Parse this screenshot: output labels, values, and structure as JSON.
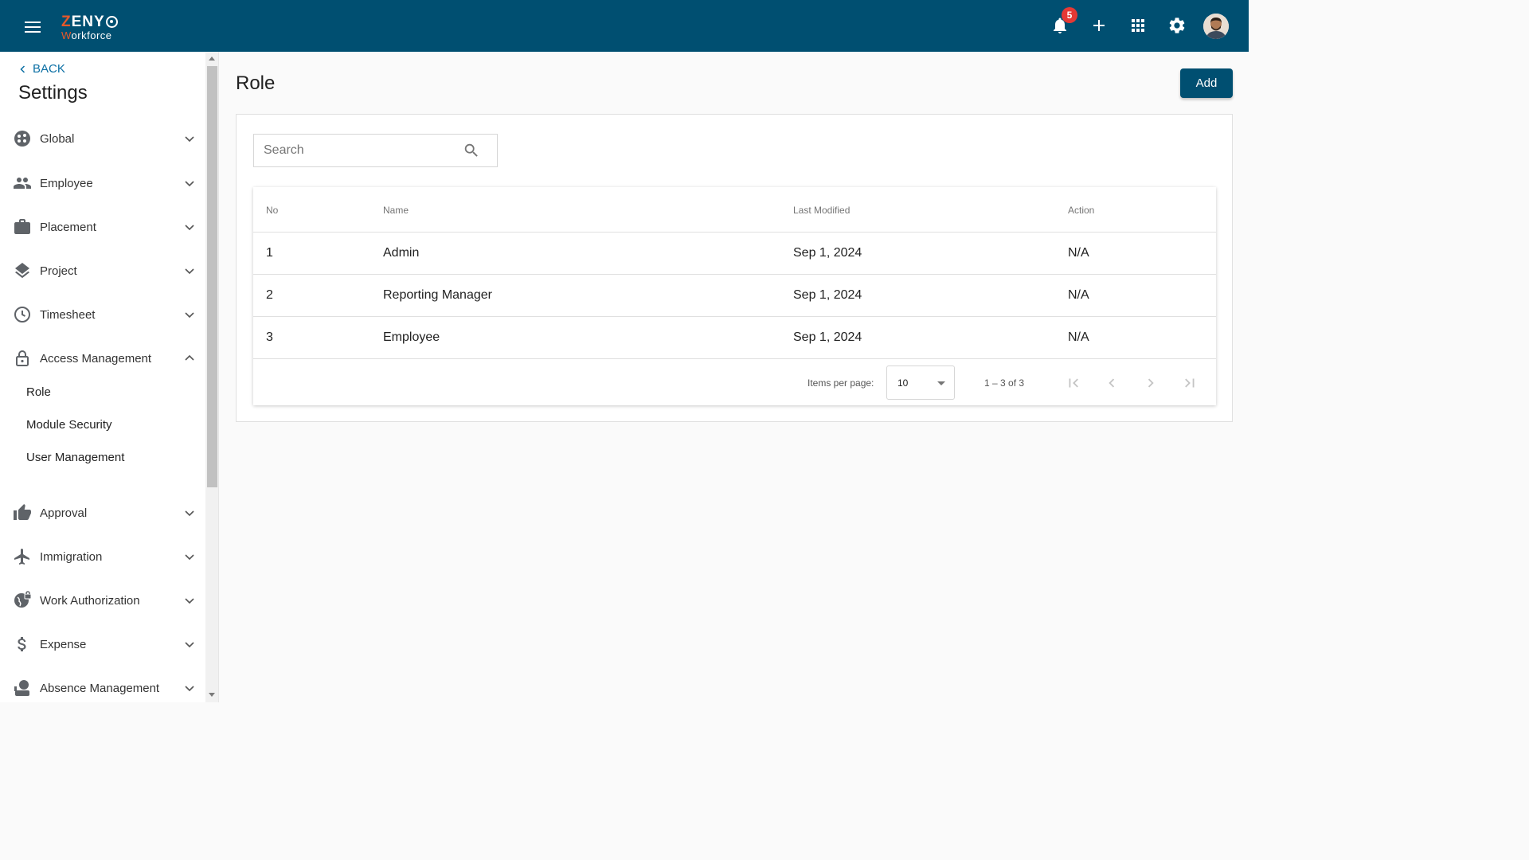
{
  "header": {
    "logo_top": "ZENY",
    "logo_bottom": "Workforce",
    "notification_count": "5",
    "icons": [
      "menu-icon",
      "bell-icon",
      "plus-icon",
      "apps-grid-icon",
      "gear-icon",
      "user-avatar"
    ]
  },
  "sidebar": {
    "back_label": "BACK",
    "title": "Settings",
    "items": [
      {
        "label": "Global",
        "icon": "global-icon",
        "expanded": false
      },
      {
        "label": "Employee",
        "icon": "people-icon",
        "expanded": false
      },
      {
        "label": "Placement",
        "icon": "briefcase-icon",
        "expanded": false
      },
      {
        "label": "Project",
        "icon": "layers-icon",
        "expanded": false
      },
      {
        "label": "Timesheet",
        "icon": "clock-icon",
        "expanded": false
      },
      {
        "label": "Access Management",
        "icon": "lock-icon",
        "expanded": true
      },
      {
        "label": "Approval",
        "icon": "thumbs-up-icon",
        "expanded": false
      },
      {
        "label": "Immigration",
        "icon": "airplane-icon",
        "expanded": false
      },
      {
        "label": "Work Authorization",
        "icon": "globe-lock-icon",
        "expanded": false
      },
      {
        "label": "Expense",
        "icon": "dollar-icon",
        "expanded": false
      },
      {
        "label": "Absence Management",
        "icon": "absence-icon",
        "expanded": false
      }
    ],
    "sub_items": [
      "Role",
      "Module Security",
      "User Management"
    ]
  },
  "main": {
    "title": "Role",
    "add_label": "Add",
    "search_placeholder": "Search",
    "table": {
      "headers": [
        "No",
        "Name",
        "Last Modified",
        "Action"
      ],
      "rows": [
        [
          "1",
          "Admin",
          "Sep 1, 2024",
          "N/A"
        ],
        [
          "2",
          "Reporting Manager",
          "Sep 1, 2024",
          "N/A"
        ],
        [
          "3",
          "Employee",
          "Sep 1, 2024",
          "N/A"
        ]
      ]
    },
    "paginator": {
      "items_per_page_label": "Items per page:",
      "items_per_page_value": "10",
      "range_label": "1 – 3 of 3"
    }
  },
  "colors": {
    "header_bg": "#004f71",
    "accent_orange": "#e8582a",
    "link_blue": "#0b6fa4",
    "badge_red": "#e53935",
    "icon_gray": "#5f6368"
  }
}
